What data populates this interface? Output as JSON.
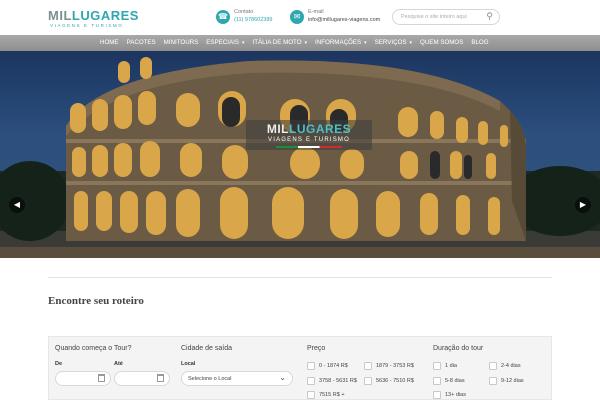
{
  "header": {
    "logo_word_a": "MIL",
    "logo_word_b": "LUGARES",
    "logo_sub": "VIAGENS E TURISMO",
    "phone_label": "Contato",
    "phone_value": "(11) 978602389",
    "email_label": "E-mail",
    "email_value": "info@millugares-viagens.com",
    "search_placeholder": "Pesquise o site inteiro aqui"
  },
  "nav": {
    "items": [
      {
        "label": "HOME",
        "has_menu": false
      },
      {
        "label": "PACOTES",
        "has_menu": false
      },
      {
        "label": "MINITOURS",
        "has_menu": false
      },
      {
        "label": "ESPECIAIS",
        "has_menu": true
      },
      {
        "label": "ITÁLIA DE MOTO",
        "has_menu": true
      },
      {
        "label": "INFORMAÇÕES",
        "has_menu": true
      },
      {
        "label": "SERVIÇOS",
        "has_menu": true
      },
      {
        "label": "QUEM SOMOS",
        "has_menu": false
      },
      {
        "label": "BLOG",
        "has_menu": false
      }
    ]
  },
  "hero": {
    "badge_word_a": "MIL",
    "badge_word_b": "LUGARES",
    "badge_sub": "VIAGENS E TURISMO",
    "prev_icon": "chevron-left-icon",
    "next_icon": "chevron-right-icon"
  },
  "finder": {
    "title": "Encontre seu roteiro",
    "start": {
      "heading": "Quando começa o Tour?",
      "from_label": "De",
      "to_label": "Até"
    },
    "city": {
      "heading": "Cidade de saída",
      "label": "Local",
      "selected": "Selecione o Local"
    },
    "price": {
      "heading": "Preço",
      "options": [
        "0 - 1874 R$",
        "1879 - 3753 R$",
        "3758 - 5631 R$",
        "5636 - 7510 R$",
        "7515 R$ +"
      ]
    },
    "duration": {
      "heading": "Duração do tour",
      "options": [
        "1 dia",
        "2-4 dias",
        "5-8 dias",
        "9-12 dias",
        "13+ dias"
      ]
    }
  },
  "colors": {
    "accent": "#2ea8b0",
    "nav": "#999999"
  }
}
